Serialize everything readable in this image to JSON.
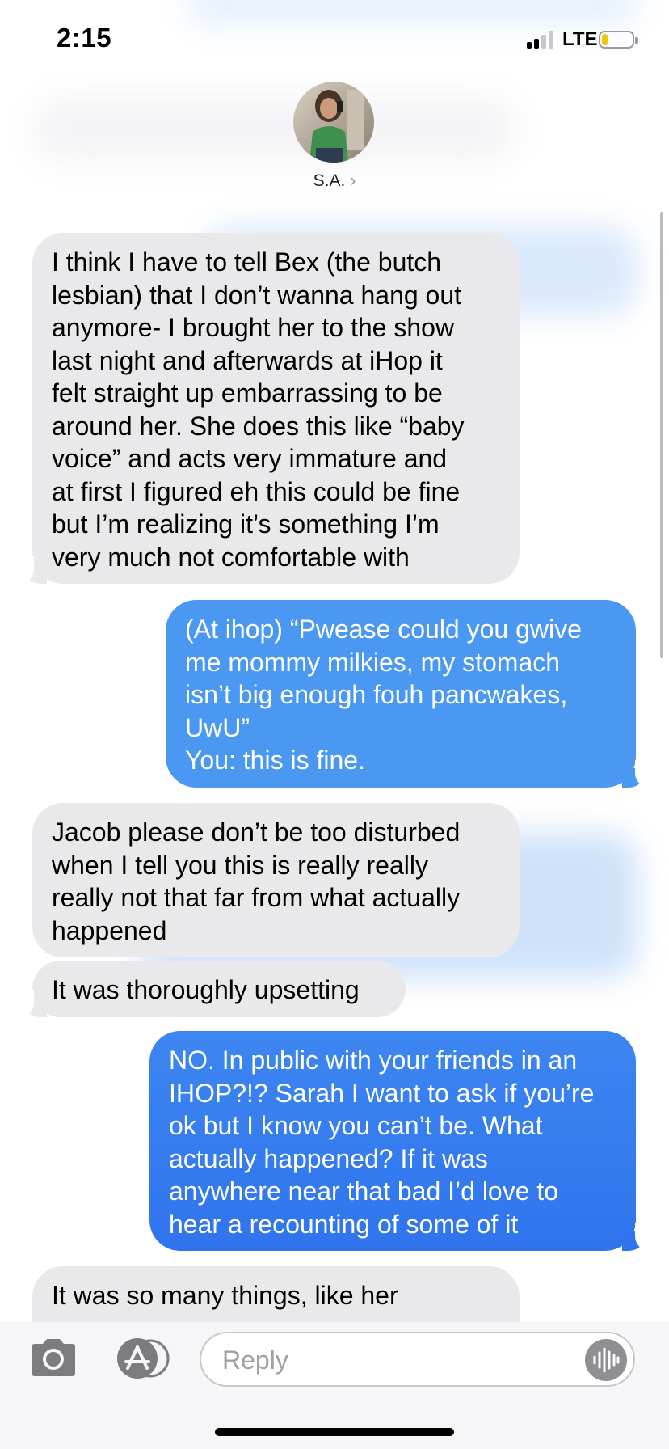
{
  "status_bar": {
    "time": "2:15",
    "network": "LTE",
    "signal_bars_active": 2,
    "signal_bars_total": 4,
    "battery_level": 0.2,
    "battery_color": "#f1c40f"
  },
  "contact": {
    "name": "S.A.",
    "chevron": "›",
    "avatar_icon": "contact-photo"
  },
  "messages": [
    {
      "direction": "incoming",
      "lines": [
        "I think I have to tell Bex (the butch",
        "lesbian) that I don’t wanna hang out",
        "anymore- I brought her to the show",
        "last night and afterwards at iHop it",
        "felt straight up embarrassing to be",
        "around her. She does this like “baby",
        "voice” and acts very immature and",
        "at first I figured eh this could be fine",
        "but I’m realizing it’s something I’m",
        "very much not comfortable with"
      ]
    },
    {
      "direction": "outgoing",
      "lines": [
        "(At ihop) “Pwease could you gwive",
        "me mommy milkies, my stomach",
        "isn’t big enough fouh pancwakes,",
        "UwU”",
        "You: this is fine."
      ]
    },
    {
      "direction": "incoming",
      "lines": [
        "Jacob please don’t be too disturbed",
        "when I tell you this is really really",
        "really not that far from what actually",
        "happened"
      ]
    },
    {
      "direction": "incoming",
      "lines": [
        "It was thoroughly upsetting"
      ]
    },
    {
      "direction": "outgoing",
      "lines": [
        "NO. In public with your friends in an",
        "IHOP?!? Sarah I want to ask if you’re",
        "ok but I know you can’t be. What",
        "actually happened? If it was",
        "anywhere near that bad I’d love to",
        "hear a recounting of some of it"
      ]
    },
    {
      "direction": "incoming",
      "lines": [
        "It was so many things, like her"
      ]
    }
  ],
  "colors": {
    "incoming_bubble": "#e9e9eb",
    "outgoing_bubble_top": "#4a98f2",
    "outgoing_bubble_bottom": "#2f74ee"
  },
  "input_bar": {
    "placeholder": "Reply",
    "camera_icon": "camera-icon",
    "appstore_icon": "app-store-icon",
    "audio_icon": "audio-waveform-icon"
  }
}
